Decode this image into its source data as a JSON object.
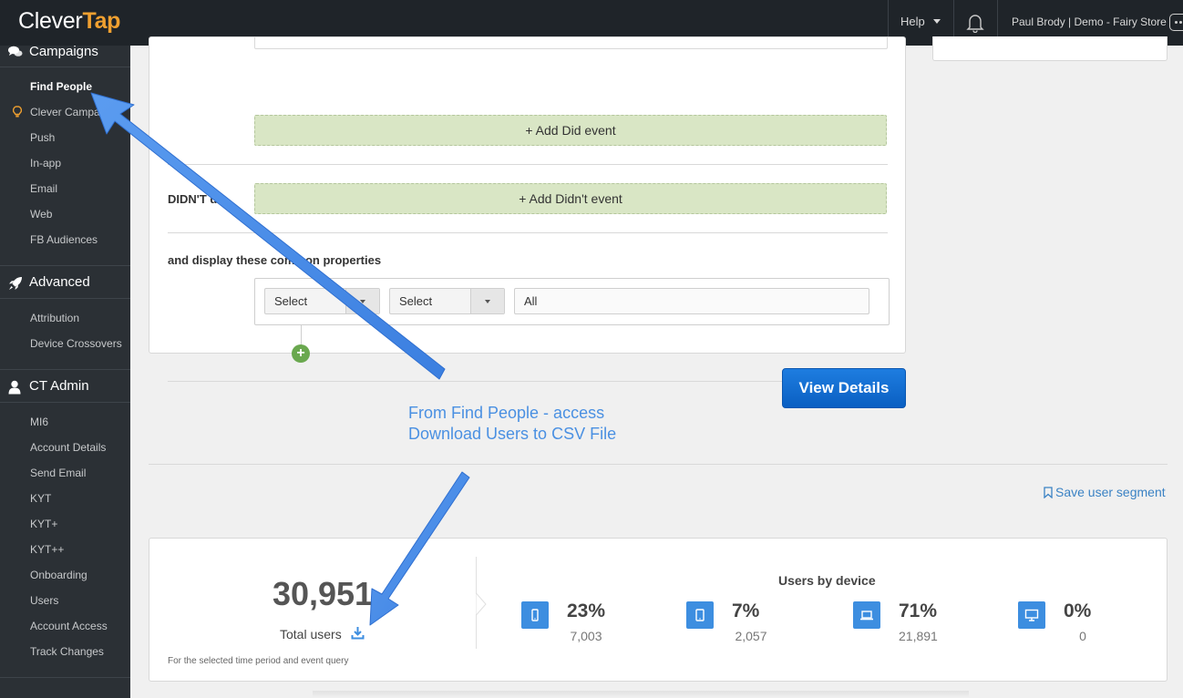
{
  "app": {
    "logo_text": "Clever",
    "logo_accent": "Tap",
    "brand_accent": "#f0a030"
  },
  "topbar": {
    "help_label": "Help",
    "account_label": "Paul Brody | Demo - Fairy Store"
  },
  "sidebar": {
    "campaigns": {
      "title": "Campaigns",
      "items": [
        "Find People",
        "Clever Campaign",
        "Push",
        "In-app",
        "Email",
        "Web",
        "FB Audiences"
      ]
    },
    "advanced": {
      "title": "Advanced",
      "items": [
        "Attribution",
        "Device Crossovers"
      ]
    },
    "ct_admin": {
      "title": "CT Admin",
      "items": [
        "MI6",
        "Account Details",
        "Send Email",
        "KYT",
        "KYT+",
        "KYT++",
        "Onboarding",
        "Users",
        "Account Access",
        "Track Changes"
      ]
    }
  },
  "query": {
    "add_did_label": "+ Add Did event",
    "didnt_label": "DIDN'T do",
    "add_didnt_label": "+ Add Didn't event",
    "display_label": "and display these common properties",
    "select_1": "Select",
    "select_2": "Select",
    "all_value": "All",
    "plus_label": "+"
  },
  "view_details_label": "View Details",
  "annotation": {
    "line1": "From Find People - access",
    "line2": "Download Users to CSV File",
    "color": "#4a90e2"
  },
  "save_segment_label": "Save user segment",
  "stats": {
    "total_value": "30,951",
    "total_label": "Total users",
    "footnote": "For the selected time period and event query",
    "device_title": "Users by device",
    "devices": [
      {
        "icon": "phone-icon",
        "pct": "23%",
        "count": "7,003"
      },
      {
        "icon": "tablet-icon",
        "pct": "7%",
        "count": "2,057"
      },
      {
        "icon": "laptop-icon",
        "pct": "71%",
        "count": "21,891"
      },
      {
        "icon": "desktop-icon",
        "pct": "0%",
        "count": "0"
      }
    ]
  }
}
